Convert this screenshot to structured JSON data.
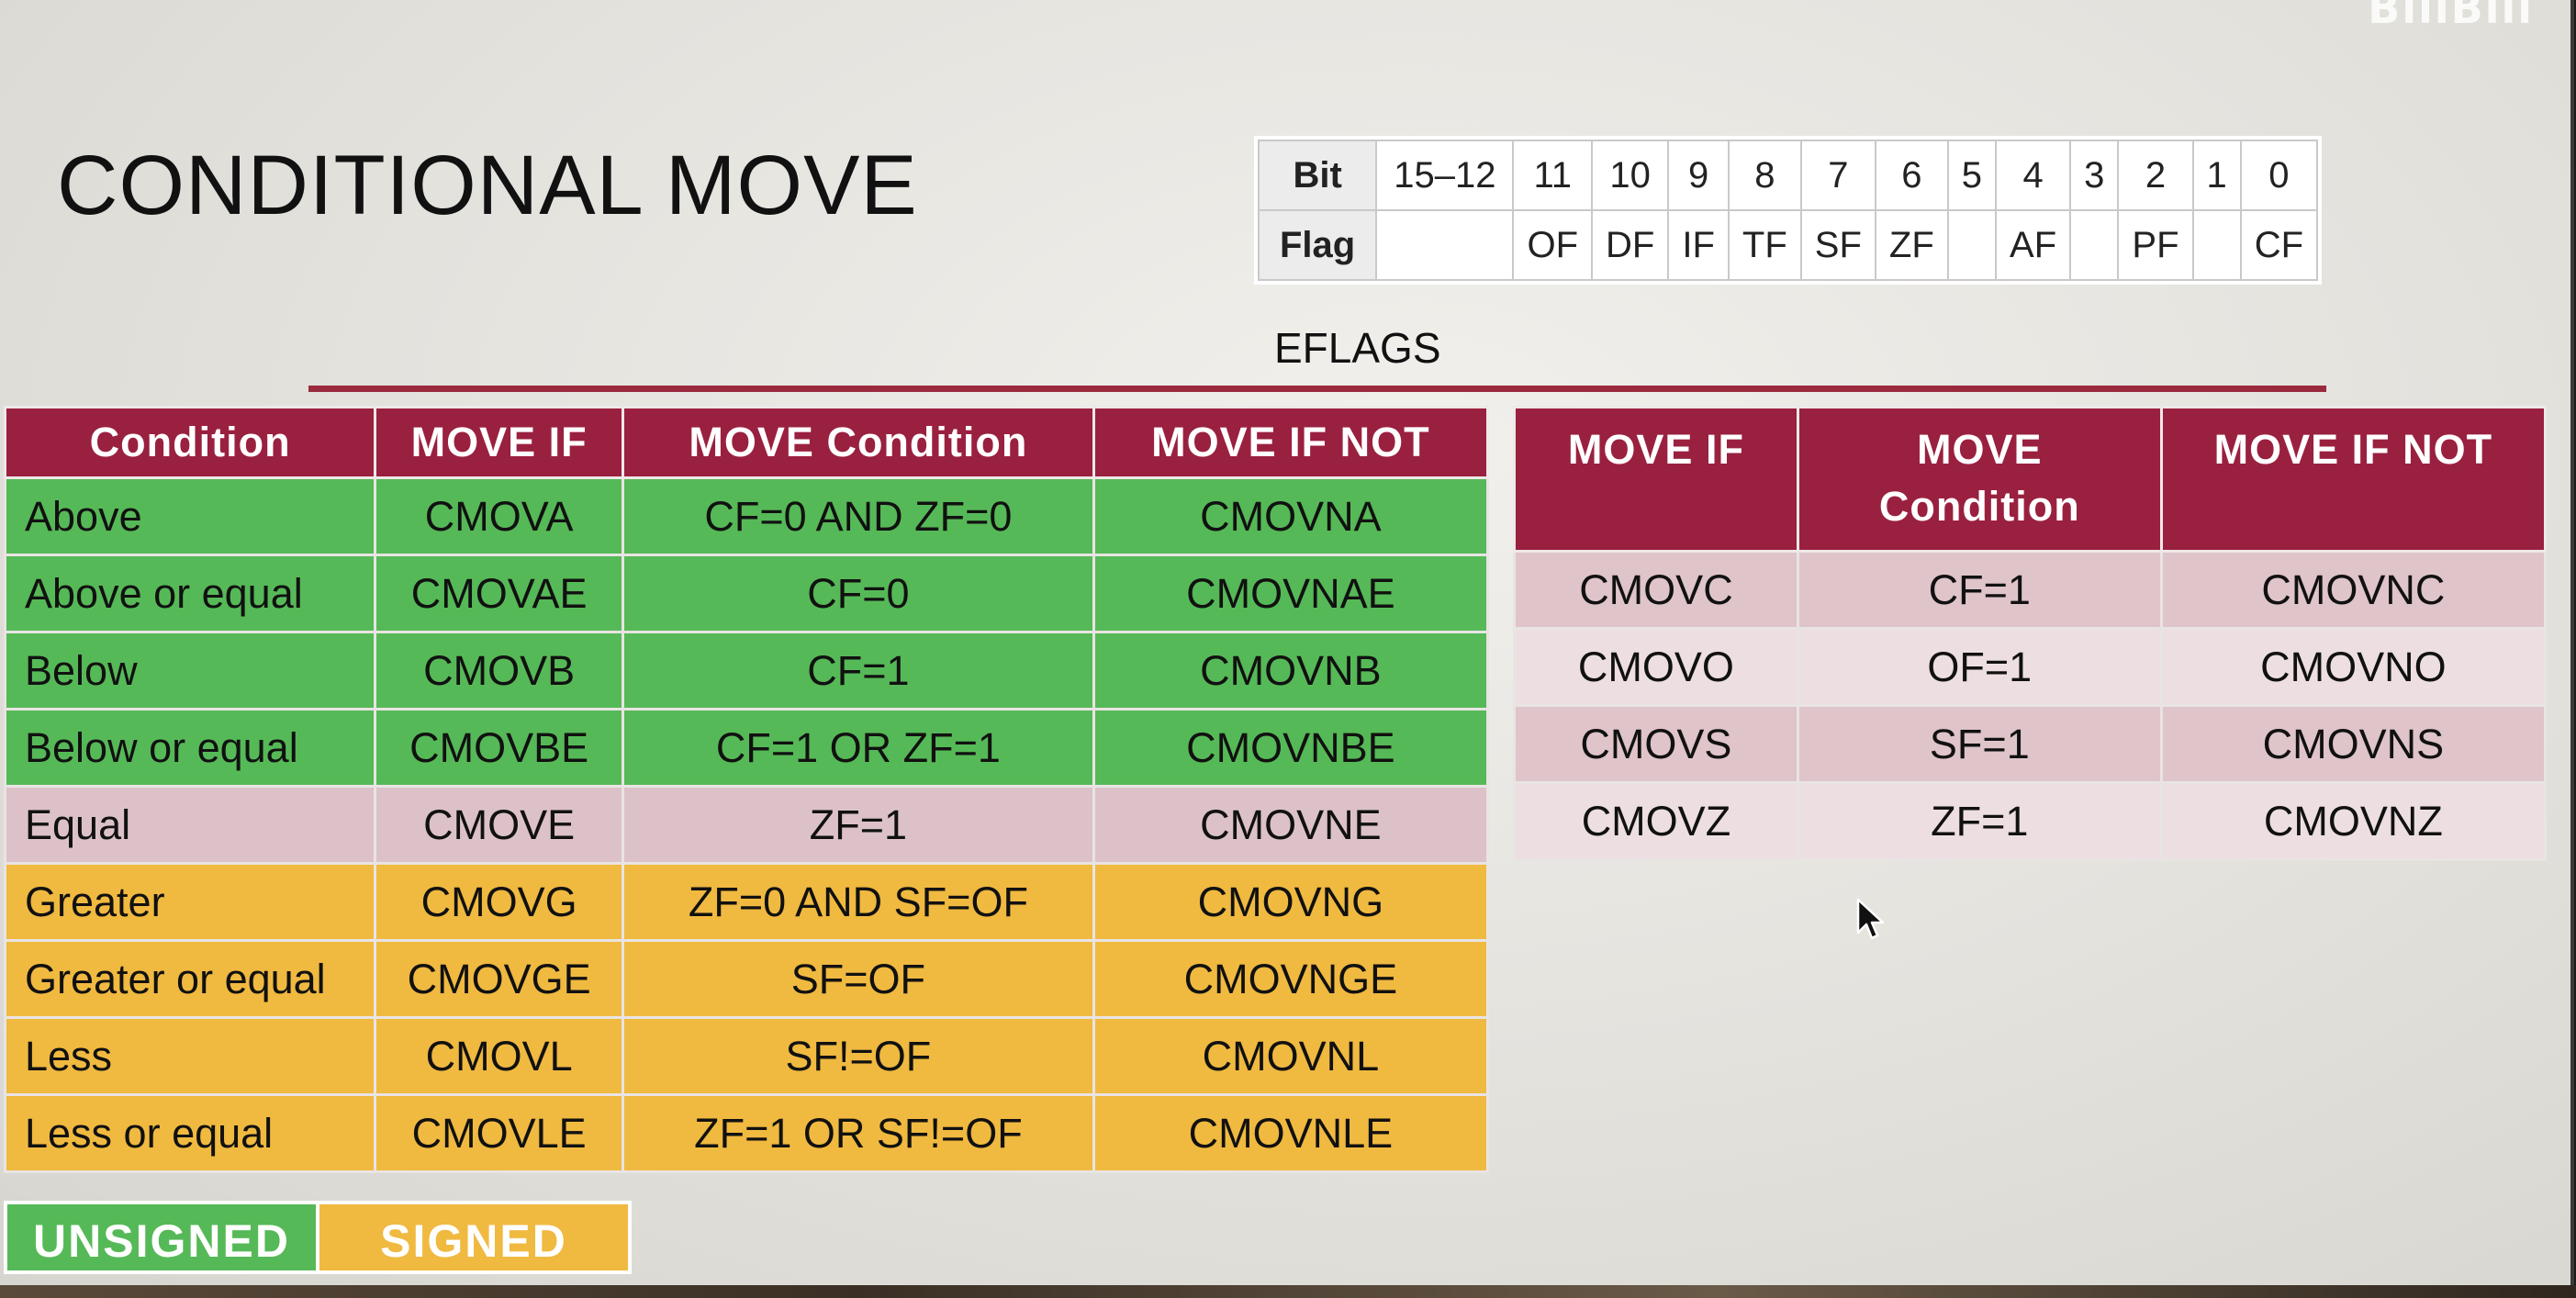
{
  "watermark": "BiliBili",
  "title": "CONDITIONAL MOVE",
  "eflags": {
    "label": "EFLAGS",
    "bit_header": "Bit",
    "flag_header": "Flag",
    "bits": [
      "15–12",
      "11",
      "10",
      "9",
      "8",
      "7",
      "6",
      "5",
      "4",
      "3",
      "2",
      "1",
      "0"
    ],
    "flags": [
      "",
      "OF",
      "DF",
      "IF",
      "TF",
      "SF",
      "ZF",
      "",
      "AF",
      "",
      "PF",
      "",
      "CF"
    ]
  },
  "table1": {
    "headers": [
      "Condition",
      "MOVE IF",
      "MOVE Condition",
      "MOVE IF NOT"
    ],
    "rows": [
      [
        "Above",
        "CMOVA",
        "CF=0 AND ZF=0",
        "CMOVNA"
      ],
      [
        "Above or equal",
        "CMOVAE",
        "CF=0",
        "CMOVNAE"
      ],
      [
        "Below",
        "CMOVB",
        "CF=1",
        "CMOVNB"
      ],
      [
        "Below or equal",
        "CMOVBE",
        "CF=1 OR ZF=1",
        "CMOVNBE"
      ],
      [
        "Equal",
        "CMOVE",
        "ZF=1",
        "CMOVNE"
      ],
      [
        "Greater",
        "CMOVG",
        "ZF=0 AND SF=OF",
        "CMOVNG"
      ],
      [
        "Greater or equal",
        "CMOVGE",
        "SF=OF",
        "CMOVNGE"
      ],
      [
        "Less",
        "CMOVL",
        "SF!=OF",
        "CMOVNL"
      ],
      [
        "Less or equal",
        "CMOVLE",
        "ZF=1 OR SF!=OF",
        "CMOVNLE"
      ]
    ]
  },
  "table2": {
    "headers": [
      "MOVE IF",
      "MOVE Condition",
      "MOVE IF NOT"
    ],
    "rows": [
      [
        "CMOVC",
        "CF=1",
        "CMOVNC"
      ],
      [
        "CMOVO",
        "OF=1",
        "CMOVNO"
      ],
      [
        "CMOVS",
        "SF=1",
        "CMOVNS"
      ],
      [
        "CMOVZ",
        "ZF=1",
        "CMOVNZ"
      ]
    ]
  },
  "legend": {
    "unsigned": "UNSIGNED",
    "signed": "SIGNED"
  },
  "colors": {
    "header": "#9a2040",
    "unsigned": "#56b957",
    "equal": "#dcc2c8",
    "signed": "#f0b940"
  }
}
